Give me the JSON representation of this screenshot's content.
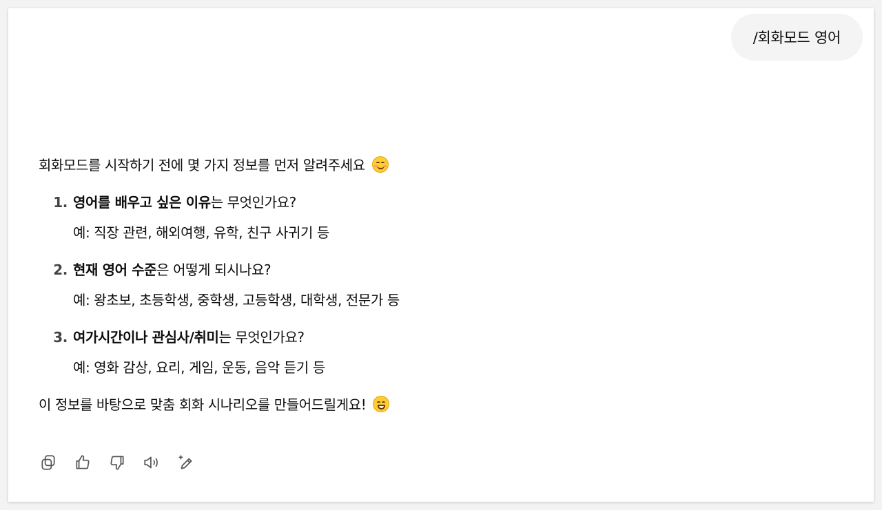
{
  "user_message": "/회화모드 영어",
  "assistant": {
    "intro": "회화모드를 시작하기 전에 몇 가지 정보를 먼저 알려주세요",
    "intro_emoji": "smiling-face-emoji",
    "questions": [
      {
        "number": "1.",
        "bold": "영어를 배우고 싶은 이유",
        "rest": "는 무엇인가요?",
        "example": "예: 직장 관련, 해외여행, 유학, 친구 사귀기 등"
      },
      {
        "number": "2.",
        "bold": "현재 영어 수준",
        "rest": "은 어떻게 되시나요?",
        "example": "예: 왕초보, 초등학생, 중학생, 고등학생, 대학생, 전문가 등"
      },
      {
        "number": "3.",
        "bold": "여가시간이나 관심사/취미",
        "rest": "는 무엇인가요?",
        "example": "예: 영화 감상, 요리, 게임, 운동, 음악 듣기 등"
      }
    ],
    "closing": "이 정보를 바탕으로 맞춤 회화 시나리오를 만들어드릴게요!",
    "closing_emoji": "grinning-face-emoji"
  },
  "action_icons": [
    "copy-icon",
    "thumbs-up-icon",
    "thumbs-down-icon",
    "read-aloud-icon",
    "edit-sparkle-icon"
  ]
}
